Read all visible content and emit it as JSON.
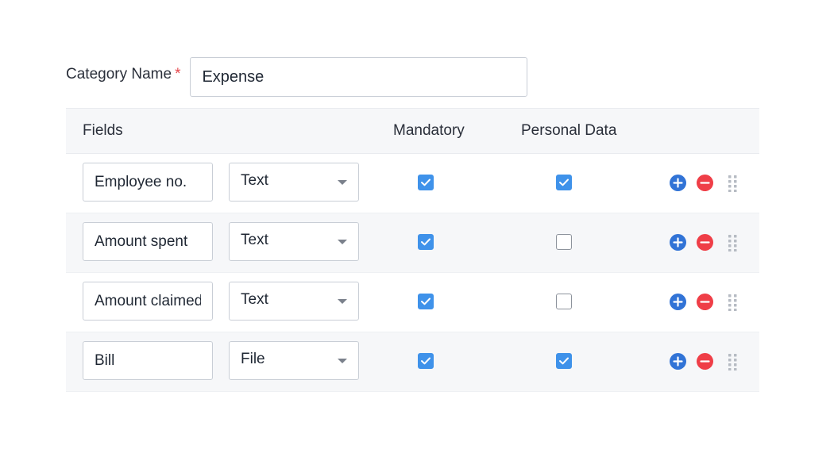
{
  "category": {
    "label": "Category Name",
    "required_marker": "*",
    "value": "Expense"
  },
  "table": {
    "headers": {
      "fields": "Fields",
      "mandatory": "Mandatory",
      "personal_data": "Personal Data"
    },
    "rows": [
      {
        "field": "Employee no.",
        "type": "Text",
        "mandatory": true,
        "personal_data": true
      },
      {
        "field": "Amount spent",
        "type": "Text",
        "mandatory": true,
        "personal_data": false
      },
      {
        "field": "Amount claimed",
        "type": "Text",
        "mandatory": true,
        "personal_data": false
      },
      {
        "field": "Bill",
        "type": "File",
        "mandatory": true,
        "personal_data": true
      }
    ]
  },
  "icons": {
    "add": "plus-circle-icon",
    "remove": "minus-circle-icon",
    "drag": "drag-handle-icon",
    "dropdown": "chevron-down-icon"
  },
  "colors": {
    "accent": "#3f92ea",
    "add": "#3173d6",
    "remove": "#ef3e47",
    "required": "#e5484d"
  }
}
